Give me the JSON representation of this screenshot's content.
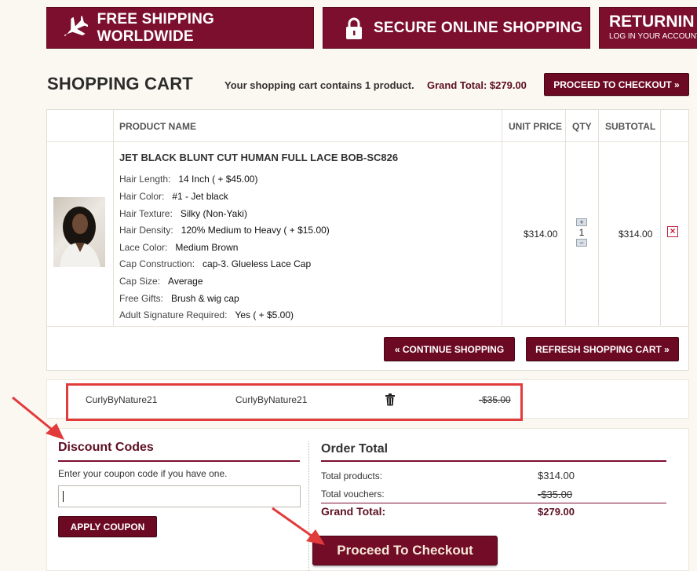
{
  "banners": [
    {
      "icon": "airplane-icon",
      "text": "FREE SHIPPING WORLDWIDE"
    },
    {
      "icon": "padlock-icon",
      "text": "SECURE ONLINE SHOPPING"
    },
    {
      "title": "RETURNIN",
      "subtitle": "LOG IN YOUR ACCOUNT"
    }
  ],
  "header": {
    "title": "SHOPPING CART",
    "summary": "Your shopping cart contains 1 product.",
    "grand_total": "Grand Total: $279.00",
    "checkout_button": "PROCEED TO CHECKOUT »"
  },
  "table": {
    "columns": [
      "PRODUCT NAME",
      "UNIT PRICE",
      "QTY",
      "SUBTOTAL"
    ],
    "item": {
      "name": "JET BLACK BLUNT CUT HUMAN FULL LACE BOB-SC826",
      "attributes": [
        {
          "label": "Hair Length:",
          "value": "14 Inch ( + $45.00)"
        },
        {
          "label": "Hair Color:",
          "value": "#1 - Jet black"
        },
        {
          "label": "Hair Texture:",
          "value": "Silky (Non-Yaki)"
        },
        {
          "label": "Hair Density:",
          "value": "120% Medium to Heavy ( + $15.00)"
        },
        {
          "label": "Lace Color:",
          "value": "Medium Brown"
        },
        {
          "label": "Cap Construction:",
          "value": "cap-3. Glueless Lace Cap"
        },
        {
          "label": "Cap Size:",
          "value": "Average"
        },
        {
          "label": "Free Gifts:",
          "value": "Brush & wig cap"
        },
        {
          "label": "Adult Signature Required:",
          "value": "Yes ( + $5.00)"
        }
      ],
      "unit_price": "$314.00",
      "qty": "1",
      "subtotal": "$314.00"
    },
    "continue_button": "« CONTINUE SHOPPING",
    "refresh_button": "REFRESH SHOPPING CART »"
  },
  "voucher": {
    "name": "CurlyByNature21",
    "code": "CurlyByNature21",
    "amount": "-$35.00"
  },
  "discount": {
    "title": "Discount Codes",
    "hint": "Enter your coupon code if you have one.",
    "input_value": "",
    "apply_button": "APPLY COUPON"
  },
  "order_total": {
    "title": "Order Total",
    "rows": [
      {
        "label": "Total products:",
        "value": "$314.00"
      },
      {
        "label": "Total vouchers:",
        "value": "-$35.00"
      }
    ],
    "grand_label": "Grand Total:",
    "grand_value": "$279.00",
    "proceed_button": "Proceed To Checkout"
  },
  "colors": {
    "brand": "#7c0f2e",
    "annotation": "#e23b3b",
    "background": "#fbf8f1"
  }
}
